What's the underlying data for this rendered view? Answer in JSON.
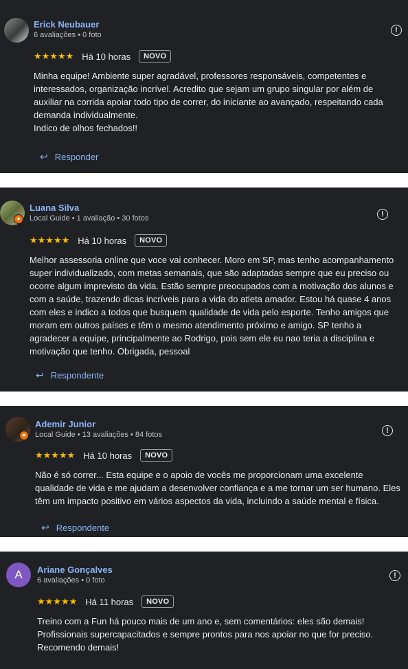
{
  "reviews": [
    {
      "author": "Erick Neubauer",
      "meta": "6 avaliações • 0 foto",
      "stars": "★★★★★",
      "rating": 5,
      "time": "Há 10 horas",
      "badge": "NOVO",
      "text": "Minha equipe! Ambiente super agradável, professores responsáveis, competentes e\ninteressados, organização incrível. Acredito que sejam um grupo singular por além de\nauxiliar na corrida apoiar todo tipo de correr, do iniciante ao avançado, respeitando cada\ndemanda individualmente.\nIndico de olhos fechados!!",
      "reply_label": "Responder"
    },
    {
      "author": "Luana Silva",
      "meta": "Local Guide • 1 avaliação • 30 fotos",
      "stars": "★★★★★",
      "rating": 5,
      "time": "Há 10 horas",
      "badge": "NOVO",
      "text": "Melhor assessoria online que voce vai conhecer. Moro em SP, mas tenho acompanhamento\nsuper individualizado, com metas semanais, que são adaptadas sempre que eu preciso ou\nocorre algum imprevisto da vida. Estão sempre preocupados com a motivação dos alunos e\ncom a saúde, trazendo dicas incríveis para a vida do atleta amador. Estou há quase 4 anos\ncom eles e indico a todos que busquem qualidade de vida pelo esporte. Tenho amigos que\nmoram em outros países e têm o mesmo atendimento próximo e amigo. SP tenho a\nagradecer a equipe, principalmente ao Rodrigo, pois sem ele eu nao teria a disciplina e\nmotivação que tenho. Obrigada, pessoal",
      "reply_label": "Respondente"
    },
    {
      "author": "Ademir Junior",
      "meta": "Local Guide • 13 avaliações • 84 fotos",
      "stars": "★★★★★",
      "rating": 5,
      "time": "Há 10 horas",
      "badge": "NOVO",
      "text": "Não é só correr... Esta equipe e o apoio de vocês me proporcionam uma excelente\nqualidade de vida e me ajudam a desenvolver confiança e a me tornar um ser humano. Eles\ntêm um impacto positivo em vários aspectos da vida, incluindo a saúde mental e física.",
      "reply_label": "Respondente"
    },
    {
      "author": "Ariane Gonçalves",
      "avatar_letter": "A",
      "meta": "6 avaliações • 0 foto",
      "stars": "★★★★★",
      "rating": 5,
      "time": "Há 11 horas",
      "badge": "NOVO",
      "text": "Treino com a Fun há pouco mais de um ano e, sem comentários: eles são demais!\nProfissionais supercapacitados e sempre prontos para nos apoiar no que for preciso.\nRecomendo demais!"
    }
  ],
  "colors": {
    "card_bg": "#202124",
    "name": "#8ab4f8",
    "stars": "#fbbc04",
    "reply": "#8ab4f8",
    "avatar_letter_bg": "#7e57c2",
    "local_guide_badge": "#e8710a"
  },
  "icons": {
    "info": "info-circle-icon",
    "reply": "reply-arrow-icon",
    "local_guide": "local-guide-star-icon"
  }
}
